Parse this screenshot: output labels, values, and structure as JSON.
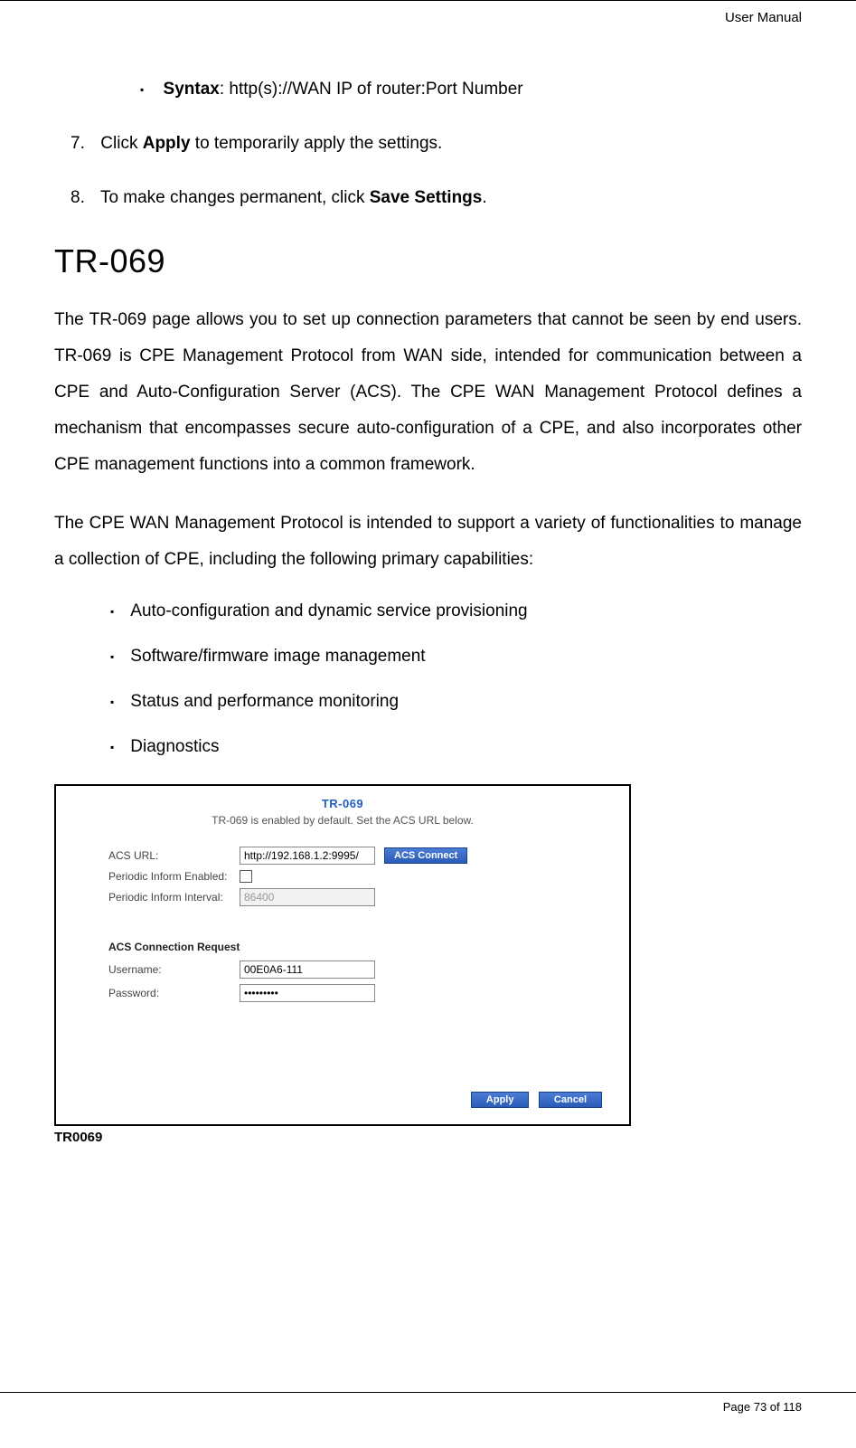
{
  "header": {
    "label": "User Manual"
  },
  "syntax": {
    "label": "Syntax",
    "value": ": http(s)://WAN IP of router:Port Number"
  },
  "steps": [
    {
      "num": "7.",
      "pre": "Click ",
      "bold": "Apply",
      "post": " to temporarily apply the settings."
    },
    {
      "num": "8.",
      "pre": "To make changes permanent, click ",
      "bold": "Save Settings",
      "post": "."
    }
  ],
  "section": {
    "title": "TR-069",
    "para1": "The TR-069 page allows you to set up connection parameters that cannot be seen by end users. TR-069 is CPE Management Protocol from WAN side, intended for communication between a CPE and Auto-Configuration Server (ACS). The CPE WAN Management Protocol defines a mechanism that encompasses secure auto-configuration of a CPE, and also incorporates other CPE management functions into a common framework.",
    "para2": "The CPE WAN Management Protocol is intended to support a variety of functionalities to manage a collection of CPE, including the following primary capabilities:",
    "caps": [
      "Auto-configuration and dynamic service provisioning",
      "Software/firmware image management",
      "Status and performance monitoring",
      "Diagnostics"
    ]
  },
  "panel": {
    "title": "TR-069",
    "subtitle": "TR-069 is enabled by default. Set the ACS URL below.",
    "acs_url_label": "ACS URL:",
    "acs_url_value": "http://192.168.1.2:9995/",
    "acs_connect_btn": "ACS Connect",
    "inform_enabled_label": "Periodic Inform Enabled:",
    "inform_interval_label": "Periodic Inform Interval:",
    "inform_interval_value": "86400",
    "acs_req_header": "ACS Connection Request",
    "username_label": "Username:",
    "username_value": "00E0A6-111",
    "password_label": "Password:",
    "password_value": "•••••••••",
    "apply_btn": "Apply",
    "cancel_btn": "Cancel"
  },
  "caption": "TR0069",
  "footer": "Page 73 of 118"
}
